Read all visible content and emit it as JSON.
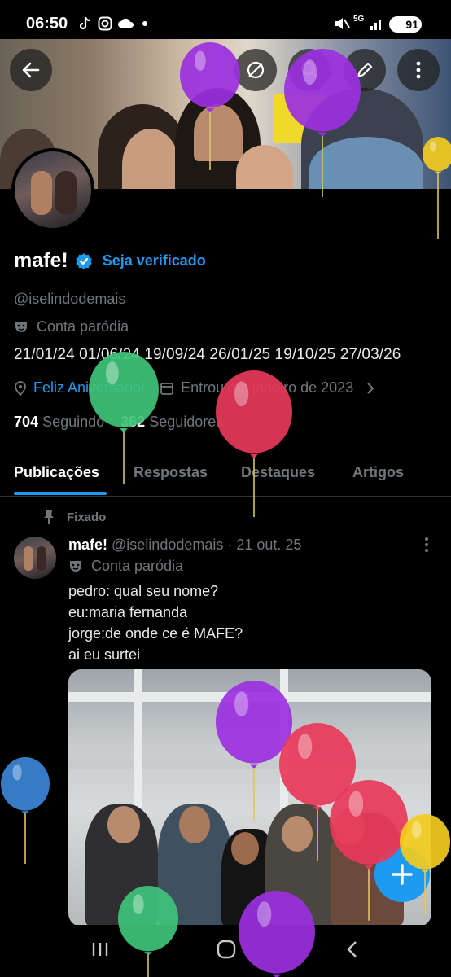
{
  "status_bar": {
    "time": "06:50",
    "battery": "91",
    "network": "5G",
    "notification_icons": [
      "tiktok-icon",
      "instagram-icon",
      "cloud-icon",
      "dot-icon"
    ],
    "system_icons": [
      "mute-icon",
      "5g-icon",
      "signal-icon",
      "battery-icon"
    ]
  },
  "header": {
    "back_icon": "arrow-left-icon",
    "actions": [
      "unsync-icon",
      "search-icon",
      "edit-icon",
      "more-vertical-icon"
    ]
  },
  "profile": {
    "name": "mafe!",
    "verify_link": "Seja verificado",
    "handle": "@iselindodemais",
    "parody_label": "Conta paródia",
    "bio": "21/01/24 01/06/24 19/09/24 26/01/25 19/10/25 27/03/26",
    "location_link": "Feliz Aniversário!",
    "joined": "Entrou em janeiro de 2023",
    "following_count": "704",
    "following_label": "Seguindo",
    "followers_count": "362",
    "followers_label": "Seguidores"
  },
  "tabs": [
    {
      "label": "Publicações",
      "active": true
    },
    {
      "label": "Respostas",
      "active": false
    },
    {
      "label": "Destaques",
      "active": false
    },
    {
      "label": "Artigos",
      "active": false
    }
  ],
  "post": {
    "pinned_label": "Fixado",
    "author": "mafe!",
    "meta": "@iselindodemais · 21 out. 25",
    "parody_label": "Conta paródia",
    "lines": [
      "pedro: qual seu nome?",
      "eu:maria fernanda",
      "jorge:de onde ce é MAFE?",
      "ai eu surtei"
    ]
  },
  "fab": {
    "icon": "plus-icon"
  },
  "nav_bar": {
    "buttons": [
      "recents-icon",
      "home-icon",
      "back-icon"
    ]
  },
  "colors": {
    "accent": "#1d9bf0",
    "background": "#000000",
    "text": "#e7e9ea",
    "muted": "#71767b",
    "balloons": [
      "#9b30e0",
      "#3fc47a",
      "#e8385a",
      "#f2cc1e",
      "#3c86d8"
    ]
  }
}
